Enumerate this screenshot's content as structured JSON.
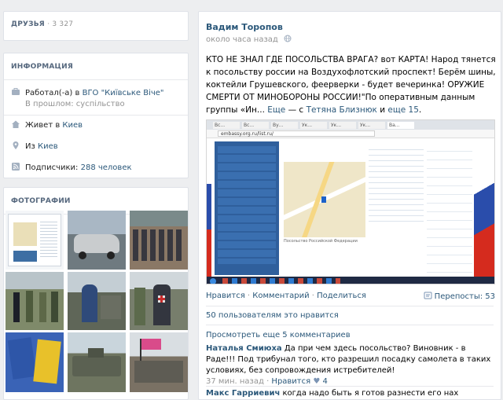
{
  "friends": {
    "label": "ДРУЗЬЯ",
    "count": "3 327"
  },
  "info": {
    "title": "ИНФОРМАЦИЯ",
    "work": {
      "prefix": "Работал(-а) в ",
      "org": "ВГО \"Київське Віче\"",
      "sub": "В прошлом: суспільство"
    },
    "lives": {
      "prefix": "Живет в ",
      "city": "Киев"
    },
    "from": {
      "prefix": "Из ",
      "city": "Киев"
    },
    "subs": {
      "prefix": "Подписчики: ",
      "count": "288 человек"
    }
  },
  "photos": {
    "title": "ФОТОГРАФИИ"
  },
  "post": {
    "author": "Вадим Торопов",
    "time": "около часа назад",
    "text_main": "КТО НЕ ЗНАЛ ГДЕ ПОСОЛЬСТВА ВРАГА? вот КАРТА! Народ тянется к посольству россии на Воздухофлотский проспект! Берём шины, коктейли Грушевского, феерверки - будет вечеринка! ОРУЖИЕ СМЕРТИ ОТ МИНОБОРОНЫ РОССИИ!\"По оперативным данным группы «Ин...",
    "more": "Еще",
    "with_prefix": "— с",
    "tagged": "Тетяна Близнюк",
    "and": "и",
    "others": "еще 15",
    "like": "Нравится",
    "comment": "Комментарий",
    "share": "Поделиться",
    "reposts": "Перепосты: 53",
    "likes_line": "50 пользователям это нравится",
    "show_more": "Просмотреть еще 5 комментариев"
  },
  "comments": [
    {
      "name": "Наталья Смиюха",
      "text": "Да при чем здесь посольство? Виновник - в Раде!!! Под трибунал того, кто разрешил посадку самолета в таких условиях, без сопровождения истребителей!",
      "time": "37 мин. назад",
      "like": "Нравится",
      "likes": "4"
    },
    {
      "name": "Макс Гарриевич",
      "text": "когда надо быть я готов разнести его нах"
    }
  ],
  "screenshot": {
    "browser_url": "embassy.org.ru/list.ru/",
    "map_caption": "Посольство Российской Федерации",
    "tabs": [
      "Вс...",
      "Вс...",
      "Ву...",
      "Ук...",
      "Ук...",
      "Ук...",
      "Ва..."
    ]
  },
  "colors": {
    "link": "#2b587a",
    "header": "#55677d",
    "muted": "#939393",
    "bg": "#edeef0"
  }
}
